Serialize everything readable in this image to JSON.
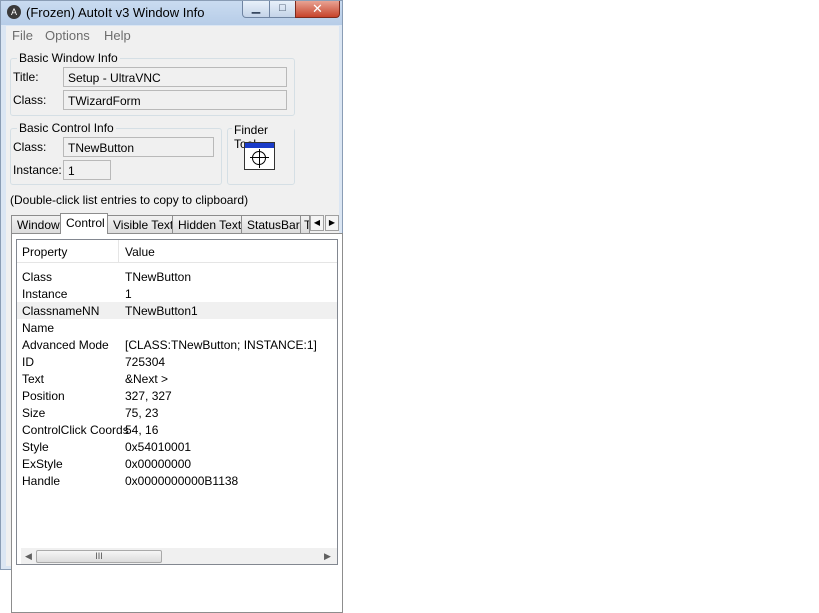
{
  "window": {
    "title": "(Frozen) AutoIt v3 Window Info",
    "app_icon": "autoit-icon",
    "controls": {
      "minimize": "minimize-icon",
      "maximize": "maximize-icon",
      "close": "close-icon"
    }
  },
  "menu": [
    {
      "label": "File"
    },
    {
      "label": "Options"
    },
    {
      "label": "Help"
    }
  ],
  "basic_window_info": {
    "heading": "Basic Window Info",
    "title_label": "Title:",
    "title_value": "Setup - UltraVNC",
    "class_label": "Class:",
    "class_value": "TWizardForm"
  },
  "basic_control_info": {
    "heading": "Basic Control Info",
    "class_label": "Class:",
    "class_value": "TNewButton",
    "instance_label": "Instance:",
    "instance_value": "1"
  },
  "finder_tool": {
    "heading": "Finder Tool",
    "icon": "crosshair-target-icon"
  },
  "hint": "(Double-click list entries to copy to clipboard)",
  "tabs": [
    {
      "label": "Window",
      "active": false
    },
    {
      "label": "Control",
      "active": true
    },
    {
      "label": "Visible Text",
      "active": false
    },
    {
      "label": "Hidden Text",
      "active": false
    },
    {
      "label": "StatusBar",
      "active": false
    },
    {
      "label": "T",
      "active": false
    }
  ],
  "tab_scroll": {
    "left": "◀",
    "right": "▶"
  },
  "list": {
    "columns": [
      "Property",
      "Value"
    ],
    "rows": [
      {
        "property": "Class",
        "value": "TNewButton"
      },
      {
        "property": "Instance",
        "value": "1"
      },
      {
        "property": "ClassnameNN",
        "value": "TNewButton1",
        "selected": true
      },
      {
        "property": "Name",
        "value": ""
      },
      {
        "property": "Advanced Mode",
        "value": "[CLASS:TNewButton; INSTANCE:1]"
      },
      {
        "property": "ID",
        "value": "725304"
      },
      {
        "property": "Text",
        "value": "&Next >"
      },
      {
        "property": "Position",
        "value": "327, 327"
      },
      {
        "property": "Size",
        "value": "75, 23"
      },
      {
        "property": "ControlClick Coords",
        "value": "54, 16"
      },
      {
        "property": "Style",
        "value": "0x54010001"
      },
      {
        "property": "ExStyle",
        "value": "0x00000000"
      },
      {
        "property": "Handle",
        "value": "0x0000000000B1138"
      }
    ]
  },
  "scrollbar": {
    "left_arrow": "◀",
    "right_arrow": "▶",
    "thumb_grip": "III"
  }
}
